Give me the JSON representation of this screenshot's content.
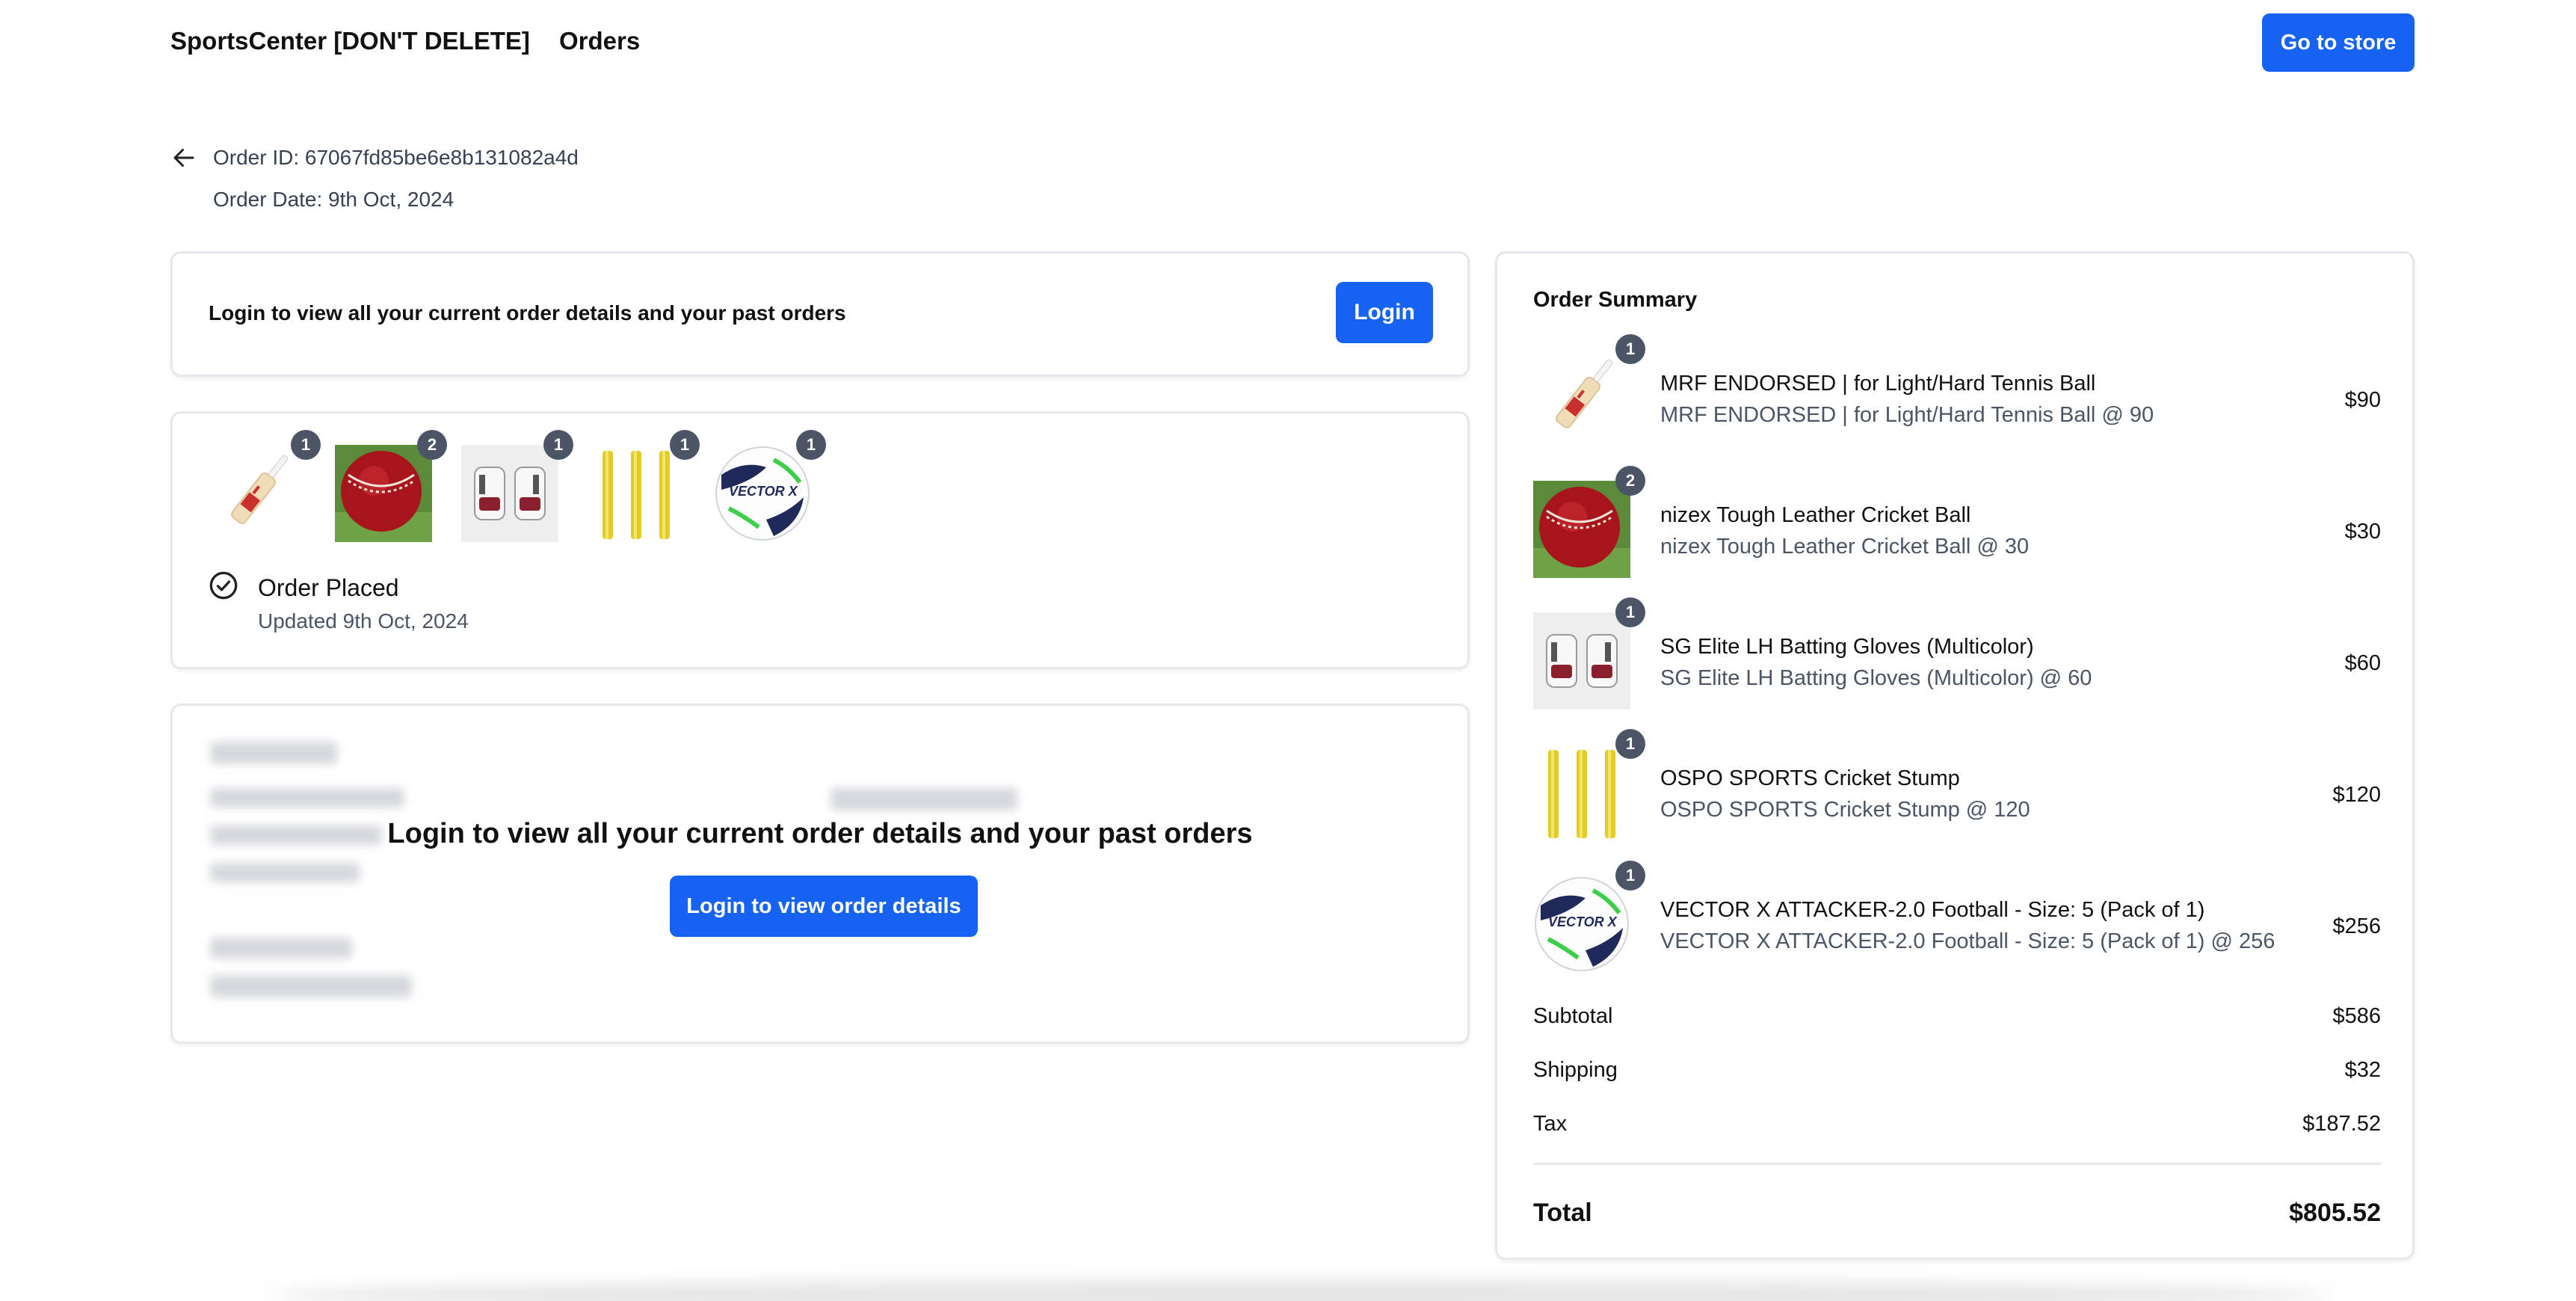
{
  "header": {
    "brand": "SportsCenter [DON'T DELETE]",
    "nav_orders": "Orders",
    "store_button": "Go to store"
  },
  "order": {
    "id_text": "Order ID: 67067fd85be6e8b131082a4d",
    "date_text": "Order Date: 9th Oct, 2024"
  },
  "login_card": {
    "message": "Login to view all your current order details and your past orders",
    "button": "Login"
  },
  "items_card": {
    "thumbs": [
      {
        "icon": "cricket-bat-icon",
        "qty": "1"
      },
      {
        "icon": "cricket-ball-icon",
        "qty": "2"
      },
      {
        "icon": "batting-gloves-icon",
        "qty": "1"
      },
      {
        "icon": "cricket-stump-icon",
        "qty": "1"
      },
      {
        "icon": "football-icon",
        "qty": "1"
      }
    ],
    "status_title": "Order Placed",
    "status_updated": "Updated 9th Oct, 2024"
  },
  "locked_card": {
    "message": "Login to view all your current order details and your past orders",
    "button": "Login to view order details"
  },
  "summary": {
    "title": "Order Summary",
    "items": [
      {
        "name": "MRF ENDORSED | for Light/Hard Tennis Ball",
        "sub": "MRF ENDORSED | for Light/Hard Tennis Ball @ 90",
        "price": "$90",
        "qty": "1",
        "icon": "cricket-bat-icon"
      },
      {
        "name": "nizex Tough Leather Cricket Ball",
        "sub": "nizex Tough Leather Cricket Ball @ 30",
        "price": "$30",
        "qty": "2",
        "icon": "cricket-ball-icon"
      },
      {
        "name": "SG Elite LH Batting Gloves (Multicolor)",
        "sub": "SG Elite LH Batting Gloves (Multicolor) @ 60",
        "price": "$60",
        "qty": "1",
        "icon": "batting-gloves-icon"
      },
      {
        "name": "OSPO SPORTS Cricket Stump",
        "sub": "OSPO SPORTS Cricket Stump @ 120",
        "price": "$120",
        "qty": "1",
        "icon": "cricket-stump-icon"
      },
      {
        "name": "VECTOR X ATTACKER-2.0 Football - Size: 5 (Pack of 1)",
        "sub": "VECTOR X ATTACKER-2.0 Football - Size: 5 (Pack of 1) @ 256",
        "price": "$256",
        "qty": "1",
        "icon": "football-icon"
      }
    ],
    "subtotal_label": "Subtotal",
    "subtotal": "$586",
    "shipping_label": "Shipping",
    "shipping": "$32",
    "tax_label": "Tax",
    "tax": "$187.52",
    "total_label": "Total",
    "total": "$805.52"
  },
  "colors": {
    "accent": "#1662f2",
    "badge": "#4b5566"
  }
}
